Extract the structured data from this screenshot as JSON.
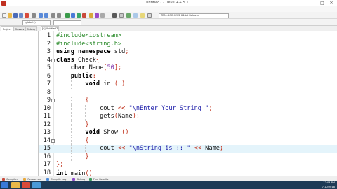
{
  "window": {
    "title": "untitled7 - Dev-C++ 5.11"
  },
  "menu": [
    "File",
    "Edit",
    "Search",
    "View",
    "Project",
    "Execute",
    "Tools",
    "AStyle",
    "Window",
    "Help"
  ],
  "toolbar": {
    "compiler_select": "TDM-GCC 4.9.2 64-bit Release",
    "globals_select": "(globals)"
  },
  "side_tabs": [
    "Project",
    "Classes",
    "Debug"
  ],
  "editor_tab": "[*] Untitled7",
  "code_lines": [
    {
      "n": "1",
      "parts": [
        {
          "c": "pp",
          "t": "#include<iostream>"
        }
      ]
    },
    {
      "n": "2",
      "parts": [
        {
          "c": "pp",
          "t": "#include<string.h>"
        }
      ]
    },
    {
      "n": "3",
      "parts": [
        {
          "c": "kw",
          "t": "using namespace "
        },
        {
          "c": "plain",
          "t": "std"
        },
        {
          "c": "sym",
          "t": ";"
        }
      ]
    },
    {
      "n": "4",
      "fold": "-",
      "parts": [
        {
          "c": "kw",
          "t": "class "
        },
        {
          "c": "plain",
          "t": "Check"
        },
        {
          "c": "sym",
          "t": "{"
        }
      ]
    },
    {
      "n": "5",
      "parts": [
        {
          "c": "plain",
          "t": "    "
        },
        {
          "c": "kw",
          "t": "char "
        },
        {
          "c": "plain",
          "t": "Name"
        },
        {
          "c": "sym",
          "t": "["
        },
        {
          "c": "num",
          "t": "50"
        },
        {
          "c": "sym",
          "t": "];"
        }
      ]
    },
    {
      "n": "6",
      "parts": [
        {
          "c": "plain",
          "t": "    "
        },
        {
          "c": "kw",
          "t": "public"
        },
        {
          "c": "sym",
          "t": ":"
        }
      ]
    },
    {
      "n": "7",
      "parts": [
        {
          "c": "plain",
          "t": "        "
        },
        {
          "c": "kw",
          "t": "void "
        },
        {
          "c": "plain",
          "t": "in "
        },
        {
          "c": "sym",
          "t": "( )"
        }
      ]
    },
    {
      "n": "8",
      "parts": []
    },
    {
      "n": "9",
      "fold": "-",
      "parts": [
        {
          "c": "plain",
          "t": "        "
        },
        {
          "c": "sym",
          "t": "{"
        }
      ]
    },
    {
      "n": "10",
      "parts": [
        {
          "c": "plain",
          "t": "            cout "
        },
        {
          "c": "sym",
          "t": "<< "
        },
        {
          "c": "str",
          "t": "\"\\nEnter Your String \""
        },
        {
          "c": "sym",
          "t": ";"
        }
      ]
    },
    {
      "n": "11",
      "parts": [
        {
          "c": "plain",
          "t": "            gets"
        },
        {
          "c": "sym",
          "t": "("
        },
        {
          "c": "plain",
          "t": "Name"
        },
        {
          "c": "sym",
          "t": ");"
        }
      ]
    },
    {
      "n": "12",
      "parts": [
        {
          "c": "plain",
          "t": "        "
        },
        {
          "c": "sym",
          "t": "}"
        }
      ]
    },
    {
      "n": "13",
      "parts": [
        {
          "c": "plain",
          "t": "        "
        },
        {
          "c": "kw",
          "t": "void "
        },
        {
          "c": "plain",
          "t": "Show "
        },
        {
          "c": "sym",
          "t": "()"
        }
      ]
    },
    {
      "n": "14",
      "fold": "-",
      "parts": [
        {
          "c": "plain",
          "t": "        "
        },
        {
          "c": "sym",
          "t": "{"
        }
      ]
    },
    {
      "n": "15",
      "hl": true,
      "parts": [
        {
          "c": "plain",
          "t": "            cout "
        },
        {
          "c": "sym",
          "t": "<< "
        },
        {
          "c": "str",
          "t": "\"\\nString is :: \""
        },
        {
          "c": "sym",
          "t": " << "
        },
        {
          "c": "plain",
          "t": "Name"
        },
        {
          "c": "sym",
          "t": ";"
        }
      ]
    },
    {
      "n": "16",
      "parts": [
        {
          "c": "plain",
          "t": "        "
        },
        {
          "c": "sym",
          "t": "}"
        }
      ]
    },
    {
      "n": "17",
      "parts": [
        {
          "c": "sym",
          "t": "};"
        }
      ]
    },
    {
      "n": "18",
      "parts": [
        {
          "c": "kw",
          "t": "int "
        },
        {
          "c": "plain",
          "t": "main"
        },
        {
          "c": "sym",
          "t": "()"
        }
      ],
      "caret": true
    }
  ],
  "bottom_tabs": [
    "Compiler",
    "Resources",
    "Compile Log",
    "Debug",
    "Find Results"
  ],
  "clock": {
    "time": "12:04 PM",
    "date": "7/10/2018"
  },
  "colors": {
    "preprocessor": "#2a8a2a",
    "string": "#1a1aa8",
    "symbol": "#c0301a",
    "number": "#7a2aa8",
    "highlight_line": "#e4f4fb",
    "taskbar": "#1e3a56"
  }
}
